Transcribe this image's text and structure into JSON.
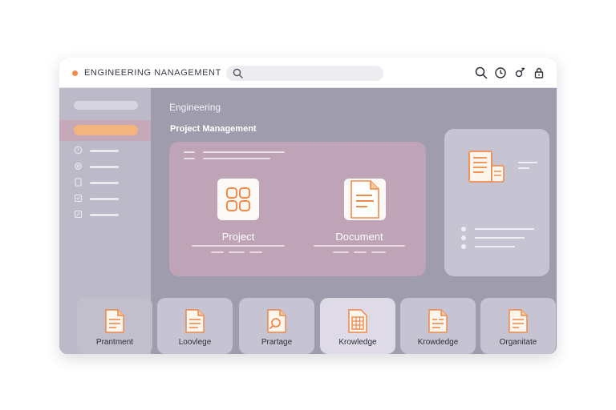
{
  "app": {
    "title": "ENGINEERING NANAGEMENT",
    "accent_color": "#ef8a4a"
  },
  "toolbar": {
    "search_placeholder": "",
    "icons": [
      "search-icon",
      "clock-icon",
      "user-icon",
      "lock-icon"
    ]
  },
  "sidebar": {
    "items": [
      {
        "icon": "clock-icon"
      },
      {
        "icon": "gear-icon"
      },
      {
        "icon": "document-icon"
      },
      {
        "icon": "checkbox-icon"
      },
      {
        "icon": "edit-icon"
      }
    ]
  },
  "main": {
    "breadcrumb": "Engineering",
    "section_title": "Project Management",
    "hero_tiles": [
      {
        "label": "Project",
        "icon": "grid-icon"
      },
      {
        "label": "Document",
        "icon": "document-icon"
      }
    ]
  },
  "cards": [
    {
      "label": "Prantment",
      "icon": "document-icon"
    },
    {
      "label": "Loovlege",
      "icon": "document-icon"
    },
    {
      "label": "Prartage",
      "icon": "search-document-icon"
    },
    {
      "label": "Krowledge",
      "icon": "spreadsheet-icon"
    },
    {
      "label": "Krowdedge",
      "icon": "document-icon"
    },
    {
      "label": "Organitate",
      "icon": "document-icon"
    }
  ]
}
